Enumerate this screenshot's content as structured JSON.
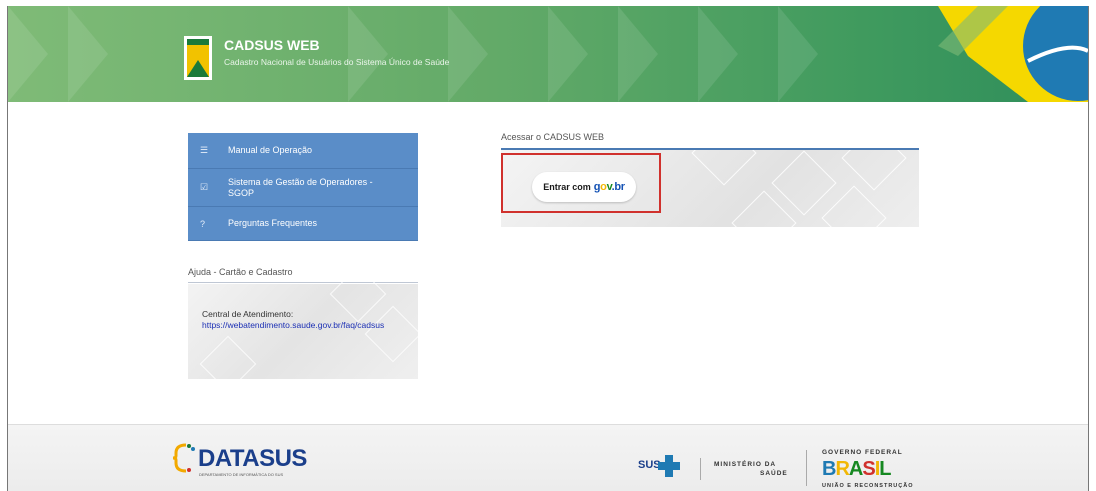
{
  "header": {
    "title": "CADSUS WEB",
    "subtitle": "Cadastro Nacional de Usuários do Sistema Único de Saúde"
  },
  "menu": {
    "items": [
      {
        "icon": "list-icon",
        "label": "Manual de Operação"
      },
      {
        "icon": "checkbox-icon",
        "label": "Sistema de Gestão de Operadores - SGOP"
      },
      {
        "icon": "question-icon",
        "label": "Perguntas Frequentes"
      }
    ]
  },
  "help": {
    "title": "Ajuda - Cartão e Cadastro",
    "label": "Central de Atendimento:",
    "link": "https://webatendimento.saude.gov.br/faq/cadsus"
  },
  "access": {
    "title": "Acessar o CADSUS WEB",
    "button_prefix": "Entrar com",
    "button_logo": "gov.br"
  },
  "footer": {
    "datasus": "DATASUS",
    "datasus_sub": "DEPARTAMENTO DE INFORMÁTICA DO SUS",
    "sus": "SUS",
    "ministerio_line1": "MINISTÉRIO DA",
    "ministerio_line2": "SAÚDE",
    "governo": "GOVERNO FEDERAL",
    "brasil": "BRASIL",
    "uniao": "UNIÃO E RECONSTRUÇÃO"
  },
  "colors": {
    "header_green": "#63aa68",
    "menu_blue": "#5a8dc8",
    "highlight_red": "#d0312d",
    "link_blue": "#1b2fb4"
  }
}
